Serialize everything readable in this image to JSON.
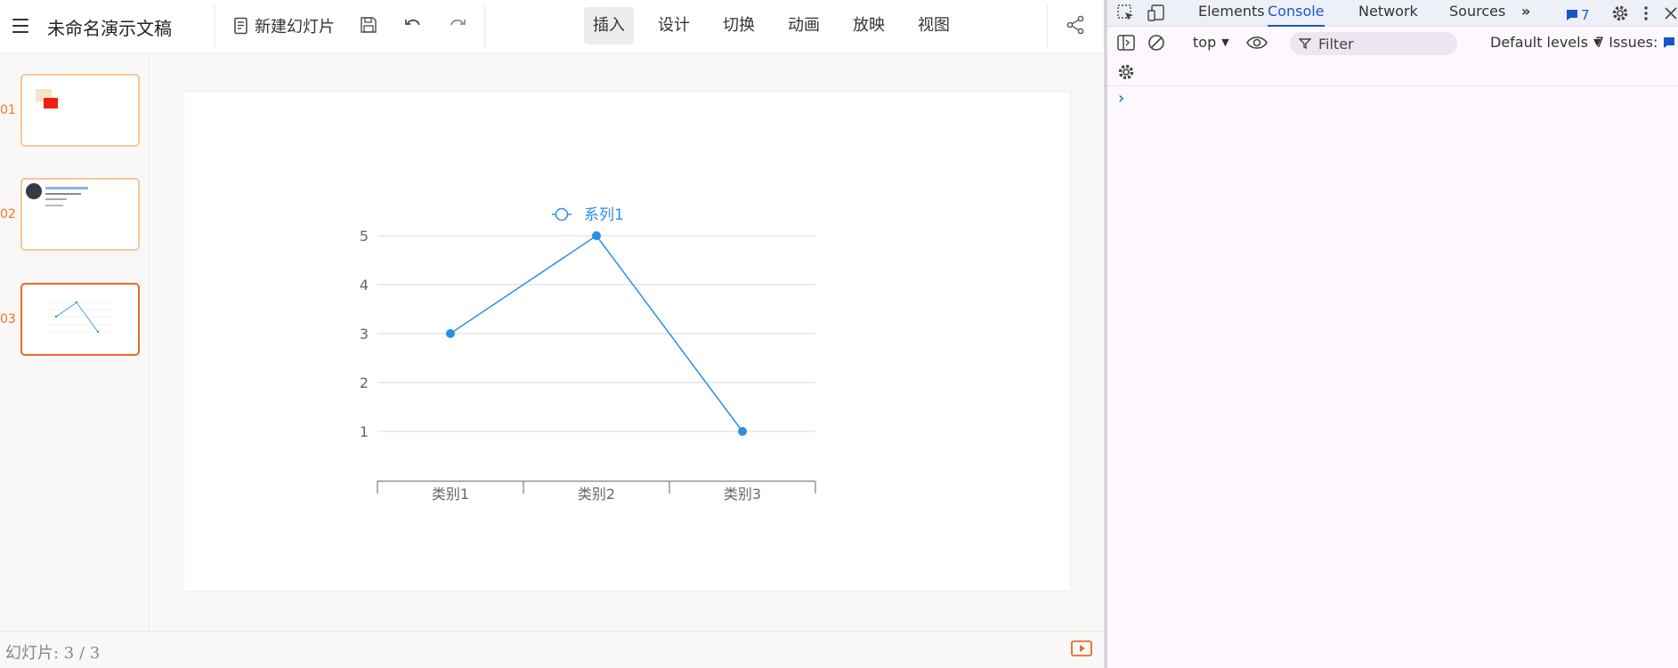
{
  "app": {
    "doc_title": "未命名演示文稿",
    "new_slide_label": "新建幻灯片",
    "tabs": [
      {
        "label": "插入",
        "active": true
      },
      {
        "label": "设计",
        "active": false
      },
      {
        "label": "切换",
        "active": false
      },
      {
        "label": "动画",
        "active": false
      },
      {
        "label": "放映",
        "active": false
      },
      {
        "label": "视图",
        "active": false
      }
    ],
    "accent_color": "#ea6a26"
  },
  "thumbnails": [
    {
      "number": "01",
      "active": false
    },
    {
      "number": "02",
      "active": false
    },
    {
      "number": "03",
      "active": true
    }
  ],
  "status": {
    "slide_counter": "幻灯片: 3 / 3"
  },
  "chart_data": {
    "type": "line",
    "categories": [
      "类别1",
      "类别2",
      "类别3"
    ],
    "series": [
      {
        "name": "系列1",
        "values": [
          3,
          5,
          1
        ],
        "color": "#2b8fe6"
      }
    ],
    "y_ticks": [
      1,
      2,
      3,
      4,
      5
    ],
    "ylim": [
      0,
      5
    ],
    "grid": true,
    "legend_position": "top-center"
  },
  "devtools": {
    "tabs": [
      "Elements",
      "Console",
      "Network",
      "Sources"
    ],
    "active_tab": "Console",
    "message_count": "7",
    "context": "top",
    "filter_placeholder": "Filter",
    "levels": "Default levels",
    "issues": "7 Issues:",
    "prompt": "›"
  }
}
